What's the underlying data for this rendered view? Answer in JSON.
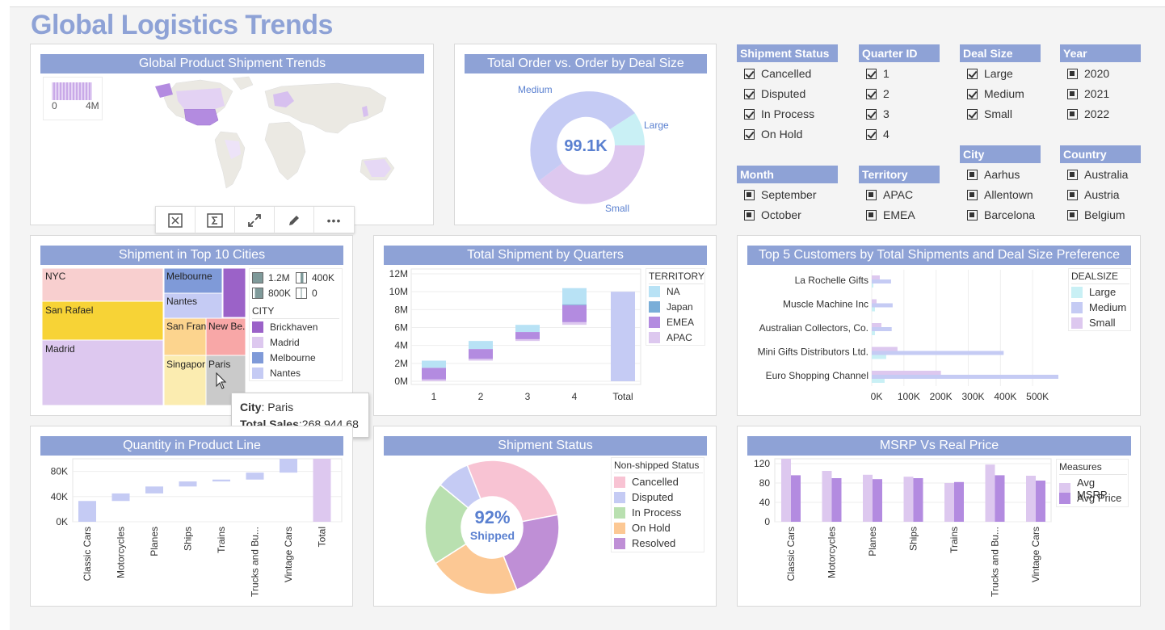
{
  "page_title": "Global Logistics Trends",
  "map_panel": {
    "title": "Global Product Shipment Trends",
    "legend_min": "0",
    "legend_max": "4M"
  },
  "toolbar": {
    "icons": [
      "close-icon",
      "sum-icon",
      "expand-icon",
      "edit-icon",
      "more-icon"
    ],
    "more": "•••"
  },
  "donut_panel": {
    "title": "Total Order vs. Order by Deal Size",
    "center": "99.1K",
    "labels": {
      "medium": "Medium",
      "large": "Large",
      "small": "Small"
    }
  },
  "filters": {
    "shipment_status": {
      "title": "Shipment Status",
      "items": [
        "Cancelled",
        "Disputed",
        "In Process",
        "On Hold"
      ]
    },
    "quarter": {
      "title": "Quarter ID",
      "items": [
        "1",
        "2",
        "3",
        "4"
      ]
    },
    "deal_size": {
      "title": "Deal Size",
      "items": [
        "Large",
        "Medium",
        "Small"
      ]
    },
    "year": {
      "title": "Year",
      "items": [
        "2020",
        "2021",
        "2022"
      ]
    },
    "month": {
      "title": "Month",
      "items": [
        "September",
        "October"
      ]
    },
    "territory": {
      "title": "Territory",
      "items": [
        "APAC",
        "EMEA"
      ]
    },
    "city": {
      "title": "City",
      "items": [
        "Aarhus",
        "Allentown",
        "Barcelona"
      ]
    },
    "country": {
      "title": "Country",
      "items": [
        "Australia",
        "Austria",
        "Belgium"
      ]
    }
  },
  "treemap_panel": {
    "title": "Shipment in Top 10 Cities",
    "cells": [
      "NYC",
      "Melbourne",
      "Nantes",
      "San Rafael",
      "San Fran.",
      "New Be.",
      "Madrid",
      "Singapore",
      "Paris"
    ],
    "legend_size": [
      "1.2M",
      "400K",
      "800K",
      "0"
    ],
    "legend_city_title": "CITY",
    "legend_cities": [
      "Brickhaven",
      "Madrid",
      "Melbourne",
      "Nantes"
    ]
  },
  "tooltip": {
    "k1": "City",
    "v1": ": Paris",
    "k2": "Total Sales",
    "v2": ":268,944.68"
  },
  "quarters_panel": {
    "title": "Total Shipment by Quarters",
    "legend_title": "TERRITORY",
    "legend": [
      "NA",
      "Japan",
      "EMEA",
      "APAC"
    ]
  },
  "customers_panel": {
    "title": "Top 5 Customers by Total Shipments and Deal Size Preference",
    "legend_title": "DEALSIZE",
    "legend": [
      "Large",
      "Medium",
      "Small"
    ]
  },
  "product_line_panel": {
    "title": "Quantity in Product Line"
  },
  "status_panel": {
    "title": "Shipment Status",
    "center_value": "92%",
    "center_label": "Shipped",
    "legend_title": "Non-shipped Status",
    "legend": [
      "Cancelled",
      "Disputed",
      "In Process",
      "On Hold",
      "Resolved"
    ]
  },
  "msrp_panel": {
    "title": "MSRP Vs Real Price",
    "legend_title": "Measures",
    "legend": [
      "Avg MSRP",
      "Avg Price"
    ]
  },
  "colors": {
    "header": "#8ea2d6",
    "title": "#8ea2d6",
    "medium": "#c5cbf4",
    "large": "#c9f0f5",
    "small": "#ddc8ef",
    "purple": "#b38be0"
  },
  "chart_data": [
    {
      "type": "bar",
      "title": "Total Shipment by Quarters",
      "subtype": "waterfall-stacked",
      "categories": [
        "1",
        "2",
        "3",
        "4",
        "Total"
      ],
      "series": [
        {
          "name": "NA",
          "values": [
            0.8,
            0.9,
            0.8,
            1.8
          ]
        },
        {
          "name": "Japan",
          "values": [
            0,
            0,
            0,
            0.1
          ]
        },
        {
          "name": "EMEA",
          "values": [
            1.3,
            1.1,
            0.8,
            1.9
          ]
        },
        {
          "name": "APAC",
          "values": [
            0.2,
            0.2,
            0.2,
            0.3
          ]
        }
      ],
      "total": 10.0,
      "y_ticks": [
        "0M",
        "2M",
        "4M",
        "6M",
        "8M",
        "10M",
        "12M"
      ],
      "ylim": [
        0,
        12
      ]
    },
    {
      "type": "bar",
      "title": "Top 5 Customers by Total Shipments and Deal Size Preference",
      "orientation": "horizontal",
      "categories": [
        "La Rochelle Gifts",
        "Muscle Machine Inc",
        "Australian Collectors, Co.",
        "Mini Gifts Distributors Ltd.",
        "Euro Shopping Channel"
      ],
      "series": [
        {
          "name": "Large",
          "values": [
            5000,
            10000,
            10000,
            45000,
            40000
          ]
        },
        {
          "name": "Medium",
          "values": [
            60000,
            65000,
            62000,
            410000,
            580000
          ]
        },
        {
          "name": "Small",
          "values": [
            25000,
            15000,
            30000,
            80000,
            215000
          ]
        }
      ],
      "x_ticks": [
        "0K",
        "100K",
        "200K",
        "300K",
        "400K",
        "500K"
      ],
      "xlim": [
        0,
        600000
      ]
    },
    {
      "type": "bar",
      "title": "Quantity in Product Line",
      "subtype": "waterfall",
      "categories": [
        "Classic Cars",
        "Motorcycles",
        "Planes",
        "Ships",
        "Trains",
        "Trucks and Bu...",
        "Vintage Cars",
        "Total"
      ],
      "values": [
        33000,
        12000,
        11000,
        8000,
        3000,
        11000,
        22000,
        100000
      ],
      "y_ticks": [
        "0K",
        "40K",
        "80K"
      ],
      "ylim": [
        0,
        100000
      ]
    },
    {
      "type": "pie",
      "title": "Shipment Status",
      "labels": [
        "Cancelled",
        "Disputed",
        "In Process",
        "On Hold",
        "Resolved"
      ],
      "values": [
        28,
        8,
        20,
        22,
        22
      ],
      "colors": [
        "#f8c3d3",
        "#c5cbf4",
        "#b9e0b0",
        "#fcc894",
        "#bf8fd6"
      ]
    },
    {
      "type": "bar",
      "title": "MSRP Vs Real Price",
      "categories": [
        "Classic Cars",
        "Motorcycles",
        "Planes",
        "Ships",
        "Trains",
        "Trucks and Bu...",
        "Vintage Cars"
      ],
      "series": [
        {
          "name": "Avg MSRP",
          "values": [
            130,
            105,
            97,
            93,
            80,
            118,
            95
          ]
        },
        {
          "name": "Avg Price",
          "values": [
            96,
            90,
            88,
            90,
            82,
            96,
            85
          ]
        }
      ],
      "y_ticks": [
        "0",
        "40",
        "80",
        "120"
      ],
      "ylim": [
        0,
        130
      ]
    }
  ]
}
